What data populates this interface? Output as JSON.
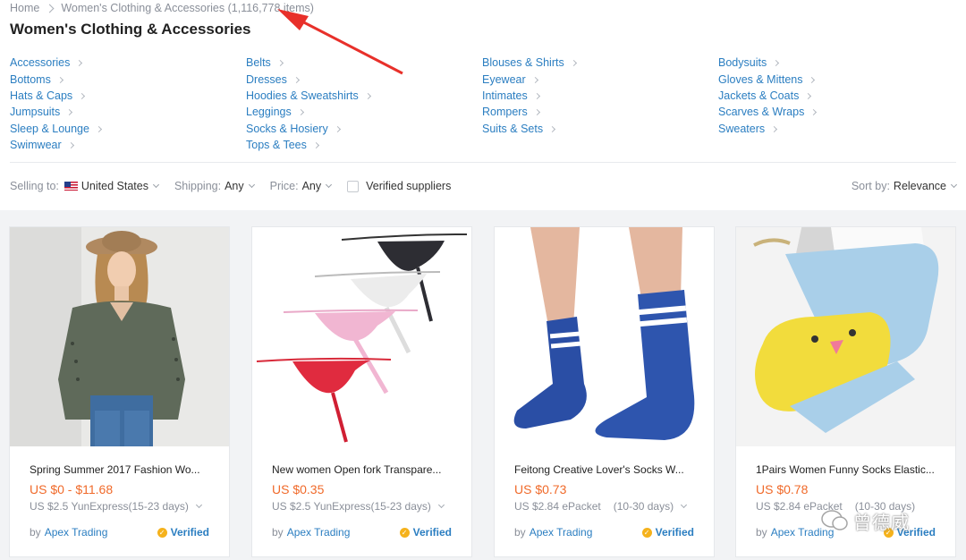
{
  "breadcrumb": {
    "home": "Home",
    "current": "Women's Clothing & Accessories (1,116,778 items)"
  },
  "page_title": "Women's Clothing & Accessories",
  "categories": [
    [
      "Accessories",
      "Bottoms",
      "Hats & Caps",
      "Jumpsuits",
      "Sleep & Lounge",
      "Swimwear"
    ],
    [
      "Belts",
      "Dresses",
      "Hoodies & Sweatshirts",
      "Leggings",
      "Socks & Hosiery",
      "Tops & Tees"
    ],
    [
      "Blouses & Shirts",
      "Eyewear",
      "Intimates",
      "Rompers",
      "Suits & Sets"
    ],
    [
      "Bodysuits",
      "Gloves & Mittens",
      "Jackets & Coats",
      "Scarves & Wraps",
      "Sweaters"
    ]
  ],
  "filters": {
    "selling_to_label": "Selling to:",
    "selling_to_value": "United States",
    "shipping_label": "Shipping:",
    "shipping_value": "Any",
    "price_label": "Price:",
    "price_value": "Any",
    "verified_label": "Verified suppliers",
    "sort_label": "Sort by:",
    "sort_value": "Relevance"
  },
  "products": [
    {
      "name": "Spring Summer 2017 Fashion Wo...",
      "price": "US $0 - $11.68",
      "shipping_cost": "US $2.5 YunExpress",
      "shipping_days": "(15-23 days)",
      "by": "by",
      "supplier": "Apex Trading",
      "verified": "Verified"
    },
    {
      "name": "New women Open fork Transpare...",
      "price": "US $0.35",
      "shipping_cost": "US $2.5 YunExpress",
      "shipping_days": "(15-23 days)",
      "by": "by",
      "supplier": "Apex Trading",
      "verified": "Verified"
    },
    {
      "name": "Feitong Creative Lover's Socks W...",
      "price": "US $0.73",
      "shipping_cost": "US $2.84 ePacket",
      "shipping_days": "(10-30 days)",
      "by": "by",
      "supplier": "Apex Trading",
      "verified": "Verified"
    },
    {
      "name": "1Pairs Women Funny Socks Elastic...",
      "price": "US $0.78",
      "shipping_cost": "US $2.84 ePacket",
      "shipping_days": "(10-30 days)",
      "by": "by",
      "supplier": "Apex Trading",
      "verified": "Verified"
    }
  ],
  "watermark": "曾德威",
  "colors": {
    "link": "#2b7ec1",
    "price": "#f06a2a",
    "verified_badge": "#f5b21c",
    "annotation_arrow": "#e8302a"
  }
}
